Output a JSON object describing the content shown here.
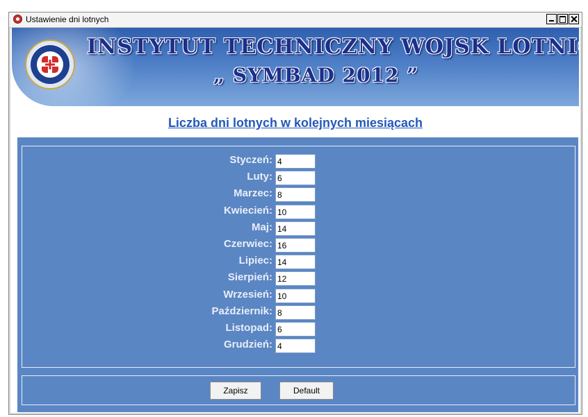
{
  "window": {
    "title": "Ustawienie dni lotnych",
    "controls": [
      "minimize",
      "maximize",
      "close"
    ]
  },
  "banner": {
    "line1": "INSTYTUT TECHNICZNY WOJSK LOTNICZYCH",
    "line2": "„ SYMBAD 2012 ”",
    "emblem_text": "INSTYTUT TECHNICZNY WOJSK LOTNICZYCH",
    "colors": {
      "top": "#2f5fae",
      "bottom": "#7ea8dc",
      "text": "#1d2f8c"
    }
  },
  "heading": "Liczba dni lotnych w kolejnych miesiącach",
  "months": [
    {
      "label": "Styczeń:",
      "value": "4"
    },
    {
      "label": "Luty:",
      "value": "6"
    },
    {
      "label": "Marzec:",
      "value": "8"
    },
    {
      "label": "Kwiecień:",
      "value": "10"
    },
    {
      "label": "Maj:",
      "value": "14"
    },
    {
      "label": "Czerwiec:",
      "value": "16"
    },
    {
      "label": "Lipiec:",
      "value": "14"
    },
    {
      "label": "Sierpień:",
      "value": "12"
    },
    {
      "label": "Wrzesień:",
      "value": "10"
    },
    {
      "label": "Październik:",
      "value": "8"
    },
    {
      "label": "Listopad:",
      "value": "6"
    },
    {
      "label": "Grudzień:",
      "value": "4"
    }
  ],
  "buttons": {
    "save": "Zapisz",
    "default": "Default"
  },
  "colors": {
    "panel": "#5b86c4",
    "label": "#e8eef8",
    "heading": "#2458b8"
  }
}
